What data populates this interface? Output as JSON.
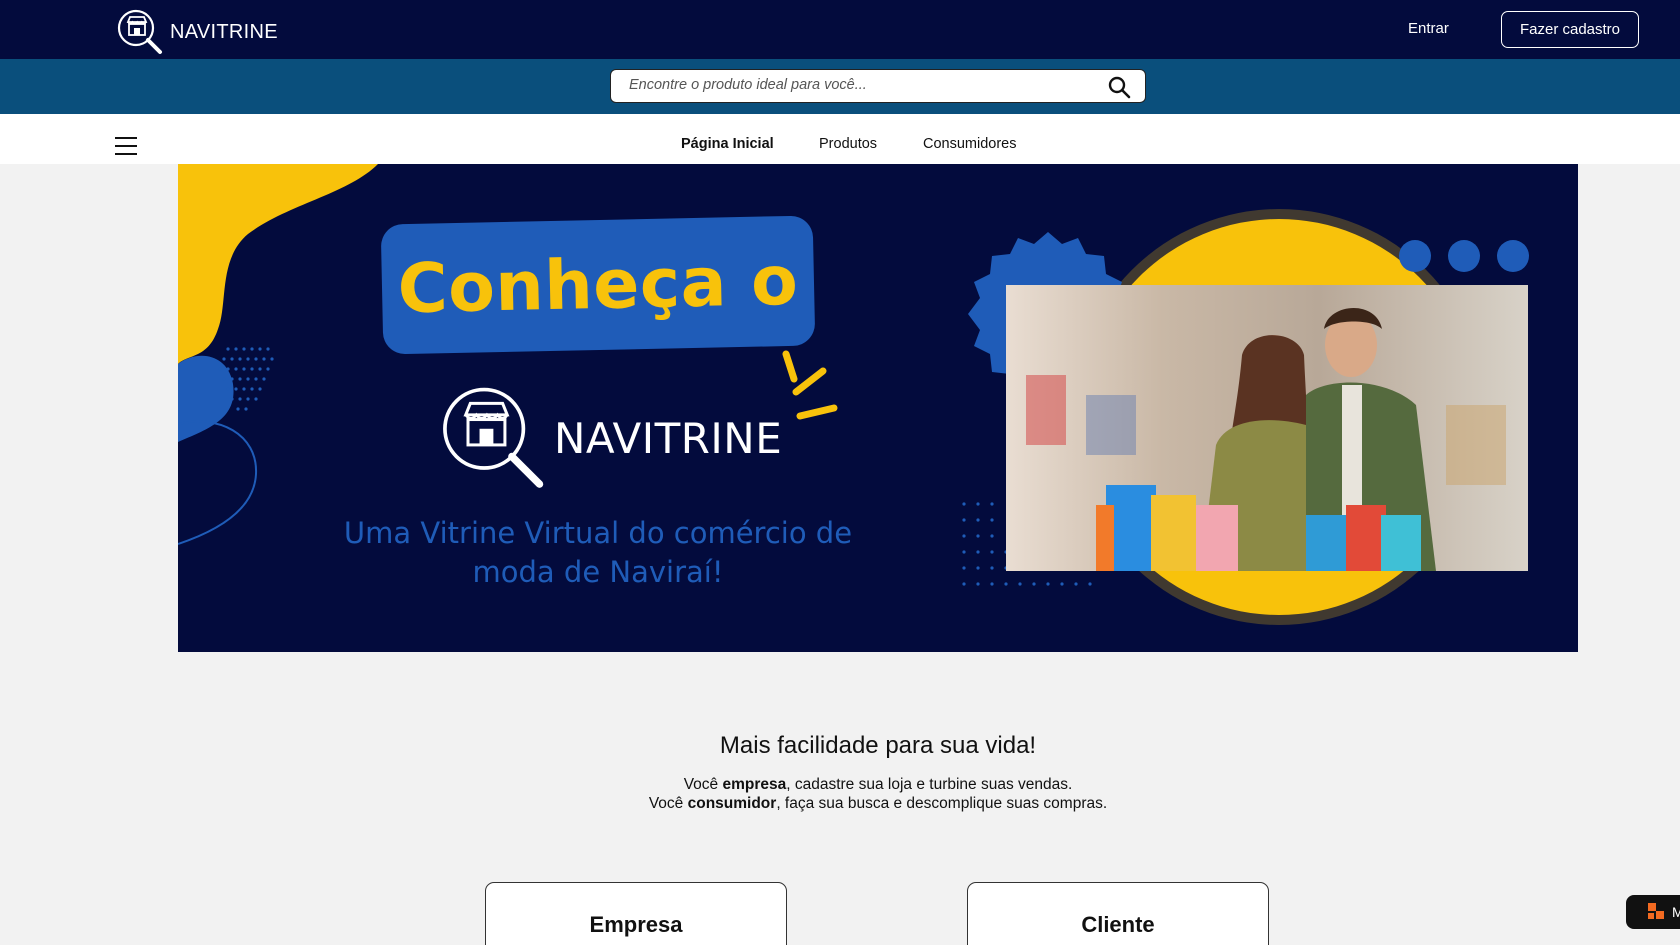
{
  "header": {
    "logo_text": "NAVITRINE",
    "login_label": "Entrar",
    "signup_label": "Fazer cadastro"
  },
  "search": {
    "placeholder": "Encontre o produto ideal para você..."
  },
  "nav": {
    "items": [
      {
        "label": "Página Inicial",
        "active": true
      },
      {
        "label": "Produtos",
        "active": false
      },
      {
        "label": "Consumidores",
        "active": false
      }
    ]
  },
  "hero": {
    "title": "Conheça o",
    "logo_text": "NAVITRINE",
    "subtitle_line1": "Uma Vitrine Virtual do comércio de",
    "subtitle_line2": "moda de Naviraí!"
  },
  "intro": {
    "title": "Mais facilidade para sua vida!",
    "line1_prefix": "Você ",
    "line1_bold": "empresa",
    "line1_suffix": ", cadastre sua loja e turbine suas vendas.",
    "line2_prefix": "Você ",
    "line2_bold": "consumidor",
    "line2_suffix": ", faça sua busca e descomplique suas compras."
  },
  "cards": [
    {
      "label": "Empresa"
    },
    {
      "label": "Cliente"
    }
  ],
  "widget": {
    "label": "M"
  },
  "colors": {
    "navy": "#030b3d",
    "search_bar": "#0a4f7c",
    "accent_blue": "#1f5cb8",
    "accent_yellow": "#f8c20b"
  },
  "icons": [
    "store-search-icon",
    "search-icon",
    "hamburger-icon"
  ]
}
